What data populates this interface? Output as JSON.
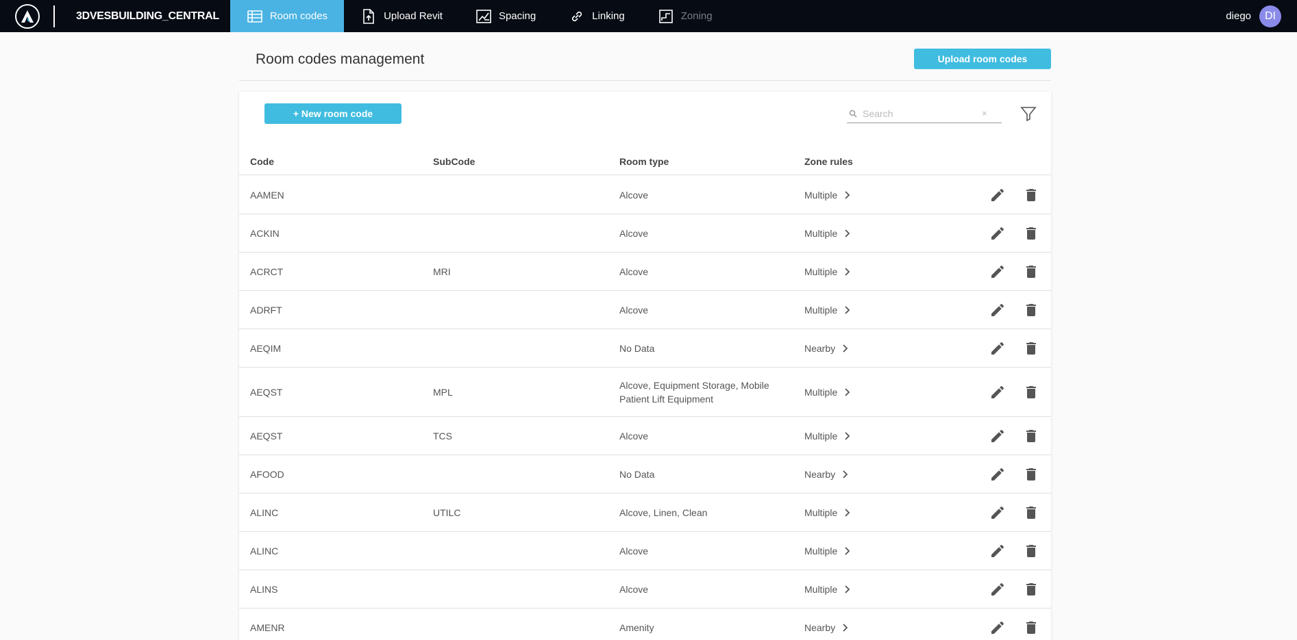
{
  "app": {
    "brand": "3DVESBUILDING_CENTRAL",
    "logo_letter": "A",
    "accent": "#4bb3e3",
    "button_color": "#40bce0"
  },
  "nav": {
    "items": [
      {
        "label": "Room codes",
        "icon": "room-codes-icon",
        "active": true
      },
      {
        "label": "Upload Revit",
        "icon": "upload-file-icon"
      },
      {
        "label": "Spacing",
        "icon": "spacing-icon"
      },
      {
        "label": "Linking",
        "icon": "link-icon"
      },
      {
        "label": "Zoning",
        "icon": "zoning-icon",
        "disabled": true
      }
    ]
  },
  "user": {
    "name": "diego",
    "initials": "DI"
  },
  "page": {
    "title": "Room codes management",
    "upload_label": "Upload room codes",
    "new_label": "+ New room code",
    "search_placeholder": "Search",
    "search_clear": "×"
  },
  "table": {
    "headers": {
      "code": "Code",
      "subcode": "SubCode",
      "room_type": "Room type",
      "zone_rules": "Zone rules"
    },
    "rows": [
      {
        "code": "AAMEN",
        "subcode": "",
        "room_type": "Alcove",
        "zone_rules": "Multiple"
      },
      {
        "code": "ACKIN",
        "subcode": "",
        "room_type": "Alcove",
        "zone_rules": "Multiple"
      },
      {
        "code": "ACRCT",
        "subcode": "MRI",
        "room_type": "Alcove",
        "zone_rules": "Multiple"
      },
      {
        "code": "ADRFT",
        "subcode": "",
        "room_type": "Alcove",
        "zone_rules": "Multiple"
      },
      {
        "code": "AEQIM",
        "subcode": "",
        "room_type": "No Data",
        "zone_rules": "Nearby"
      },
      {
        "code": "AEQST",
        "subcode": "MPL",
        "room_type": "Alcove, Equipment Storage, Mobile Patient Lift Equipment",
        "zone_rules": "Multiple"
      },
      {
        "code": "AEQST",
        "subcode": "TCS",
        "room_type": "Alcove",
        "zone_rules": "Multiple"
      },
      {
        "code": "AFOOD",
        "subcode": "",
        "room_type": "No Data",
        "zone_rules": "Nearby"
      },
      {
        "code": "ALINC",
        "subcode": "UTILC",
        "room_type": "Alcove, Linen, Clean",
        "zone_rules": "Multiple"
      },
      {
        "code": "ALINC",
        "subcode": "",
        "room_type": "Alcove",
        "zone_rules": "Multiple"
      },
      {
        "code": "ALINS",
        "subcode": "",
        "room_type": "Alcove",
        "zone_rules": "Multiple"
      },
      {
        "code": "AMENR",
        "subcode": "",
        "room_type": "Amenity",
        "zone_rules": "Nearby"
      }
    ]
  }
}
